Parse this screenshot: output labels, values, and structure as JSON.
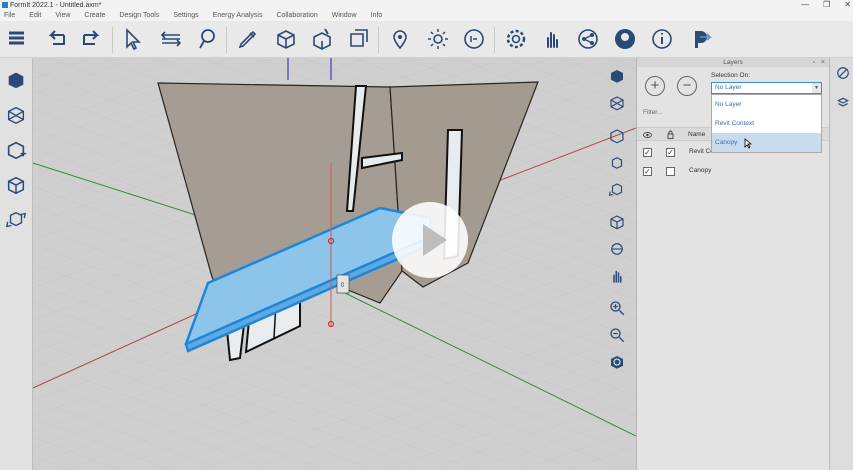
{
  "window": {
    "title": "FormIt 2022.1 - Untitled.axm*",
    "controls": [
      "—",
      "❐",
      "✕"
    ]
  },
  "menu": [
    "File",
    "Edit",
    "View",
    "Create",
    "Design Tools",
    "Settings",
    "Energy Analysis",
    "Collaboration",
    "Window",
    "Info"
  ],
  "toolbar": {
    "toolbox_icon": "layers-stack-icon"
  },
  "viewport": {
    "gizmo_label": "⇳",
    "colors": {
      "ground": "#c9c9c9",
      "wall": "#a59c93",
      "canopy": "#8cc4ea",
      "canopy_edge": "#1c87da",
      "axis_x": "#b04545",
      "axis_y": "#3a8a3a",
      "axis_z": "#3d3dc0"
    }
  },
  "layers_panel": {
    "title": "Layers",
    "add_icon": "+",
    "remove_icon": "−",
    "selection_label": "Selection On:",
    "selection_value": "No Layer",
    "dropdown_options": [
      "No Layer",
      "Revit Context",
      "Canopy"
    ],
    "filter_placeholder": "Filter...",
    "column_name": "Name",
    "rows": [
      {
        "name": "Revit Context",
        "visible": "✓",
        "locked": "✓"
      },
      {
        "name": "Canopy",
        "visible": "✓",
        "locked": ""
      }
    ]
  }
}
